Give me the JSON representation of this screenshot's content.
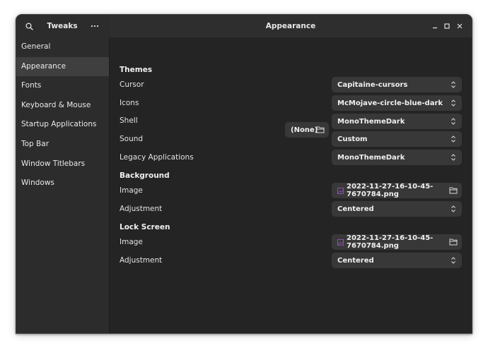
{
  "app": {
    "title": "Tweaks"
  },
  "header": {
    "page_title": "Appearance"
  },
  "icons": {
    "search": "search-icon",
    "menu": "more-horizontal-icon",
    "minimize": "minimize-icon",
    "maximize": "maximize-icon",
    "close": "close-icon",
    "combo_arrows": "chevron-up-down-icon",
    "folder": "folder-icon",
    "image_file": "image-file-icon"
  },
  "colors": {
    "window_bg": "#242424",
    "sidebar_bg": "#2c2c2c",
    "selected_bg": "#3f3f3f",
    "widget_bg": "#383838",
    "file_icon": "#8a4fb5"
  },
  "sidebar": {
    "items": [
      {
        "label": "General"
      },
      {
        "label": "Appearance",
        "selected": true
      },
      {
        "label": "Fonts"
      },
      {
        "label": "Keyboard & Mouse"
      },
      {
        "label": "Startup Applications"
      },
      {
        "label": "Top Bar"
      },
      {
        "label": "Window Titlebars"
      },
      {
        "label": "Windows"
      }
    ]
  },
  "themes": {
    "title": "Themes",
    "cursor": {
      "label": "Cursor",
      "value": "Capitaine-cursors"
    },
    "icons": {
      "label": "Icons",
      "value": "McMojave-circle-blue-dark"
    },
    "shell": {
      "label": "Shell",
      "value": "MonoThemeDark",
      "extension_button": "(None)"
    },
    "sound": {
      "label": "Sound",
      "value": "Custom"
    },
    "legacy": {
      "label": "Legacy Applications",
      "value": "MonoThemeDark"
    }
  },
  "background": {
    "title": "Background",
    "image": {
      "label": "Image",
      "value": "2022-11-27-16-10-45-7670784.png"
    },
    "adjustment": {
      "label": "Adjustment",
      "value": "Centered"
    }
  },
  "lock_screen": {
    "title": "Lock Screen",
    "image": {
      "label": "Image",
      "value": "2022-11-27-16-10-45-7670784.png"
    },
    "adjustment": {
      "label": "Adjustment",
      "value": "Centered"
    }
  }
}
